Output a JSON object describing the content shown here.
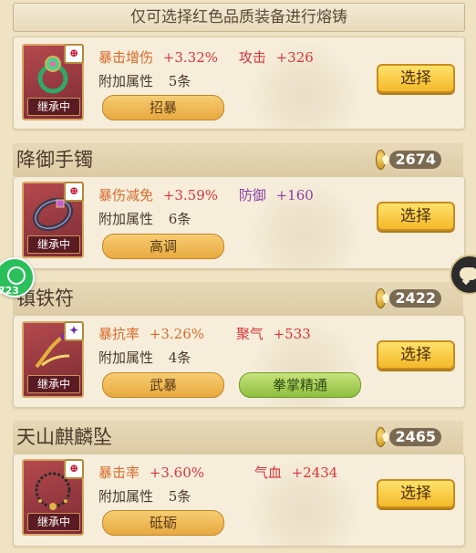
{
  "banner": {
    "text": "仅可选择红色品质装备进行熔铸"
  },
  "status_label": "继承中",
  "quality_mark": "⊕",
  "select_label": "选择",
  "attr_label": "附加属性",
  "items": [
    {
      "name": "",
      "power": "",
      "stat1_name": "暴击增伤",
      "stat1_value": "+3.32%",
      "stat2_name": "攻击",
      "stat2_value": "+326",
      "attr_count": "5条",
      "chips": [
        {
          "label": "招暴",
          "color": "gold"
        }
      ],
      "icon": "ring-icon"
    },
    {
      "name": "降御手镯",
      "power": "2674",
      "stat1_name": "暴伤减免",
      "stat1_value": "+3.59%",
      "stat2_name": "防御",
      "stat2_value": "+160",
      "attr_count": "6条",
      "chips": [
        {
          "label": "高调",
          "color": "gold"
        }
      ],
      "icon": "bracelet-icon"
    },
    {
      "name": "镇铁符",
      "power": "2422",
      "stat1_name": "暴抗率",
      "stat1_value": "+3.26%",
      "stat2_name": "聚气",
      "stat2_value": "+533",
      "attr_count": "4条",
      "chips": [
        {
          "label": "武暴",
          "color": "gold"
        },
        {
          "label": "拳掌精通",
          "color": "green"
        }
      ],
      "icon": "talisman-icon"
    },
    {
      "name": "天山麒麟坠",
      "power": "2465",
      "stat1_name": "暴击率",
      "stat1_value": "+3.60%",
      "stat2_name": "气血",
      "stat2_value": "+2434",
      "attr_count": "5条",
      "chips": [
        {
          "label": "砥砺",
          "color": "gold"
        }
      ],
      "icon": "necklace-icon"
    }
  ],
  "side_badge": {
    "number": "723"
  }
}
